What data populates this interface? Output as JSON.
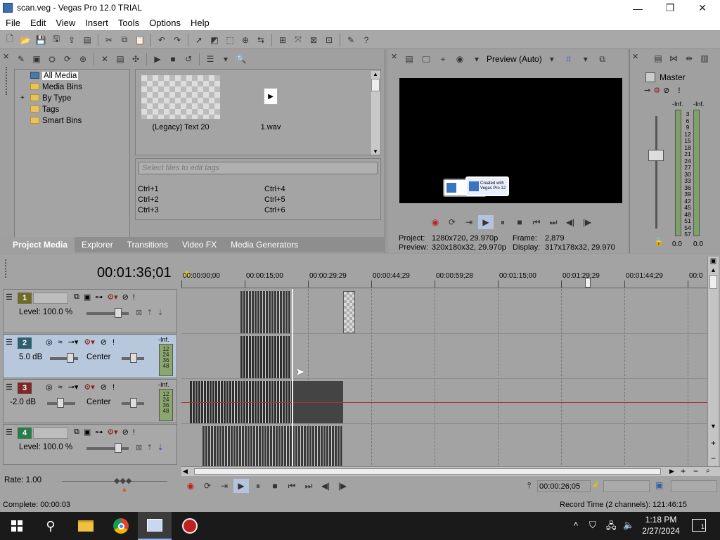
{
  "window": {
    "title": "scan.veg - Vegas Pro 12.0 TRIAL",
    "minimize": "—",
    "maximize": "❐",
    "close": "✕"
  },
  "menu": [
    "File",
    "Edit",
    "View",
    "Insert",
    "Tools",
    "Options",
    "Help"
  ],
  "project_media": {
    "tree": [
      "All Media",
      "Media Bins",
      "By Type",
      "Tags",
      "Smart Bins"
    ],
    "items": [
      {
        "label": "(Legacy) Text 20"
      },
      {
        "label": "1.wav"
      }
    ],
    "tag_placeholder": "Select files to edit tags",
    "shortcuts": [
      "Ctrl+1",
      "Ctrl+4",
      "Ctrl+2",
      "Ctrl+5",
      "Ctrl+3",
      "Ctrl+6"
    ],
    "tabs": [
      "Project Media",
      "Explorer",
      "Transitions",
      "Video FX",
      "Media Generators"
    ]
  },
  "preview": {
    "mode": "Preview (Auto)",
    "watermark": "Created with Vegas Pro 12",
    "project_label": "Project:",
    "project_value": "1280x720, 29.970p",
    "preview_label": "Preview:",
    "preview_value": "320x180x32, 29.970p",
    "frame_label": "Frame:",
    "frame_value": "2,879",
    "display_label": "Display:",
    "display_value": "317x178x32, 29.970"
  },
  "master": {
    "title": "Master",
    "inf_left": "-Inf.",
    "inf_right": "-Inf.",
    "scale": [
      "3",
      "6",
      "9",
      "12",
      "15",
      "18",
      "21",
      "24",
      "27",
      "30",
      "33",
      "36",
      "39",
      "42",
      "45",
      "48",
      "51",
      "54",
      "57"
    ],
    "bottom_left": "0.0",
    "bottom_right": "0.0"
  },
  "timeline": {
    "timecode": "00:01:36;01",
    "ruler": [
      "00:00:00;00",
      "00:00:15;00",
      "00:00:29;29",
      "00:00:44;29",
      "00:00:59;28",
      "00:01:15;00",
      "00:01:29;29",
      "00:01:44;29",
      "00:0"
    ],
    "tracks": [
      {
        "num": "1",
        "type": "video",
        "level": "Level: 100.0 %",
        "color": "#6d6a2a"
      },
      {
        "num": "2",
        "type": "audio",
        "volume": "5.0 dB",
        "pan": "Center",
        "meter": [
          "-Inf.",
          "12",
          "24",
          "36",
          "48"
        ],
        "color": "#2f5f6f"
      },
      {
        "num": "3",
        "type": "audio",
        "volume": "-2.0 dB",
        "pan": "Center",
        "meter": [
          "-Inf.",
          "12",
          "24",
          "36",
          "48"
        ],
        "color": "#7a2a2a"
      },
      {
        "num": "4",
        "type": "video",
        "level": "Level: 100.0 %",
        "color": "#2a7a4a"
      }
    ],
    "rate": "Rate: 1.00",
    "cursor_time": "00:00:26;05"
  },
  "status": {
    "complete": "Complete: 00:00:03",
    "record_time": "Record Time (2 channels): 121:46:15"
  },
  "taskbar": {
    "time": "1:18 PM",
    "date": "2/27/2024",
    "notification_count": "1",
    "icons": [
      "windows-start-icon",
      "search-icon",
      "file-explorer-icon",
      "chrome-icon",
      "vegas-pro-icon",
      "vegas-app-icon"
    ]
  }
}
